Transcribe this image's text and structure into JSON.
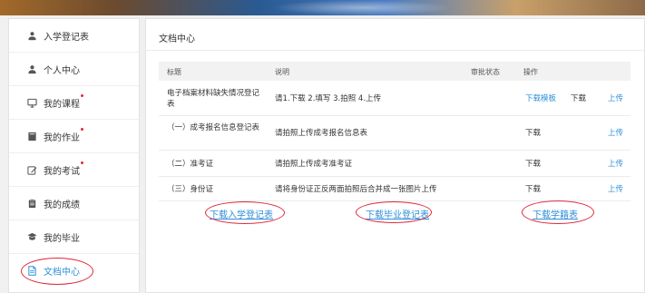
{
  "sidebar": {
    "items": [
      {
        "label": "入学登记表",
        "icon": "user-badge-icon",
        "dot": false
      },
      {
        "label": "个人中心",
        "icon": "person-icon",
        "dot": false
      },
      {
        "label": "我的课程",
        "icon": "monitor-icon",
        "dot": true
      },
      {
        "label": "我的作业",
        "icon": "book-icon",
        "dot": true
      },
      {
        "label": "我的考试",
        "icon": "edit-icon",
        "dot": true
      },
      {
        "label": "我的成绩",
        "icon": "clipboard-icon",
        "dot": false
      },
      {
        "label": "我的毕业",
        "icon": "graduation-icon",
        "dot": false
      },
      {
        "label": "文档中心",
        "icon": "document-icon",
        "dot": false,
        "active": true
      }
    ]
  },
  "main": {
    "title": "文档中心",
    "table": {
      "headers": [
        "标题",
        "说明",
        "审批状态",
        "操作"
      ],
      "rows": [
        {
          "title": "电子档案材料缺失情况登记表",
          "desc": "请1.下载 2.填写 3.拍照 4.上传",
          "status": "",
          "actions": {
            "template": "下载模板",
            "download": "下载",
            "upload": "上传"
          }
        },
        {
          "title": "（一）成考报名信息登记表",
          "desc": "请拍照上传成考报名信息表",
          "status": "",
          "actions": {
            "template": "",
            "download": "下载",
            "upload": "上传"
          }
        },
        {
          "title": "（二）准考证",
          "desc": "请拍照上传成考准考证",
          "status": "",
          "actions": {
            "template": "",
            "download": "下载",
            "upload": "上传"
          }
        },
        {
          "title": "（三）身份证",
          "desc": "请将身份证正反两面拍照后合并成一张图片上传",
          "status": "",
          "actions": {
            "template": "",
            "download": "下载",
            "upload": "上传"
          }
        }
      ]
    },
    "downloads": {
      "enrollment": "下载入学登记表",
      "graduation": "下载毕业登记表",
      "degree": "下载学籍表"
    }
  },
  "colors": {
    "accent": "#2f8fd9",
    "highlight": "#e0263a"
  }
}
